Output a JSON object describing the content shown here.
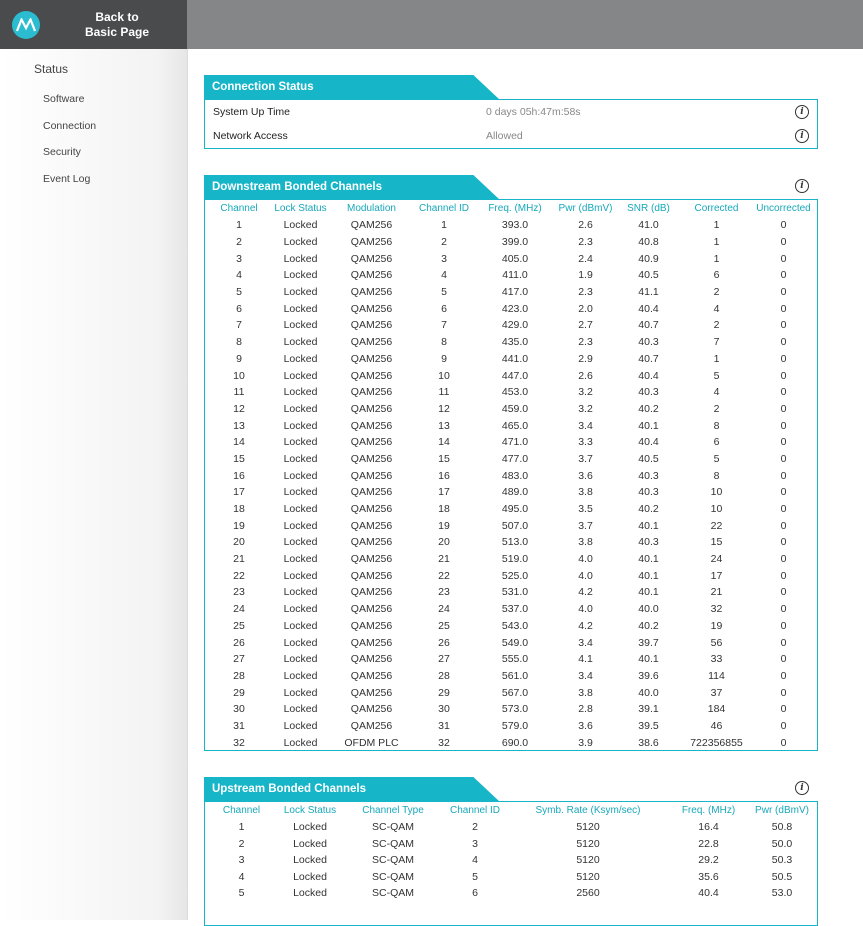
{
  "header": {
    "back_label_line1": "Back to",
    "back_label_line2": "Basic Page"
  },
  "sidebar": {
    "status_label": "Status",
    "items": [
      {
        "label": "Software"
      },
      {
        "label": "Connection"
      },
      {
        "label": "Security"
      },
      {
        "label": "Event Log"
      }
    ]
  },
  "connection_status": {
    "title": "Connection Status",
    "rows": [
      {
        "label": "System Up Time",
        "value": "0 days 05h:47m:58s"
      },
      {
        "label": "Network Access",
        "value": "Allowed"
      }
    ]
  },
  "downstream": {
    "title": "Downstream Bonded Channels",
    "columns": [
      "Channel",
      "Lock Status",
      "Modulation",
      "Channel ID",
      "Freq. (MHz)",
      "Pwr (dBmV)",
      "SNR (dB)",
      "Corrected",
      "Uncorrected"
    ],
    "rows": [
      [
        "1",
        "Locked",
        "QAM256",
        "1",
        "393.0",
        "2.6",
        "41.0",
        "1",
        "0"
      ],
      [
        "2",
        "Locked",
        "QAM256",
        "2",
        "399.0",
        "2.3",
        "40.8",
        "1",
        "0"
      ],
      [
        "3",
        "Locked",
        "QAM256",
        "3",
        "405.0",
        "2.4",
        "40.9",
        "1",
        "0"
      ],
      [
        "4",
        "Locked",
        "QAM256",
        "4",
        "411.0",
        "1.9",
        "40.5",
        "6",
        "0"
      ],
      [
        "5",
        "Locked",
        "QAM256",
        "5",
        "417.0",
        "2.3",
        "41.1",
        "2",
        "0"
      ],
      [
        "6",
        "Locked",
        "QAM256",
        "6",
        "423.0",
        "2.0",
        "40.4",
        "4",
        "0"
      ],
      [
        "7",
        "Locked",
        "QAM256",
        "7",
        "429.0",
        "2.7",
        "40.7",
        "2",
        "0"
      ],
      [
        "8",
        "Locked",
        "QAM256",
        "8",
        "435.0",
        "2.3",
        "40.3",
        "7",
        "0"
      ],
      [
        "9",
        "Locked",
        "QAM256",
        "9",
        "441.0",
        "2.9",
        "40.7",
        "1",
        "0"
      ],
      [
        "10",
        "Locked",
        "QAM256",
        "10",
        "447.0",
        "2.6",
        "40.4",
        "5",
        "0"
      ],
      [
        "11",
        "Locked",
        "QAM256",
        "11",
        "453.0",
        "3.2",
        "40.3",
        "4",
        "0"
      ],
      [
        "12",
        "Locked",
        "QAM256",
        "12",
        "459.0",
        "3.2",
        "40.2",
        "2",
        "0"
      ],
      [
        "13",
        "Locked",
        "QAM256",
        "13",
        "465.0",
        "3.4",
        "40.1",
        "8",
        "0"
      ],
      [
        "14",
        "Locked",
        "QAM256",
        "14",
        "471.0",
        "3.3",
        "40.4",
        "6",
        "0"
      ],
      [
        "15",
        "Locked",
        "QAM256",
        "15",
        "477.0",
        "3.7",
        "40.5",
        "5",
        "0"
      ],
      [
        "16",
        "Locked",
        "QAM256",
        "16",
        "483.0",
        "3.6",
        "40.3",
        "8",
        "0"
      ],
      [
        "17",
        "Locked",
        "QAM256",
        "17",
        "489.0",
        "3.8",
        "40.3",
        "10",
        "0"
      ],
      [
        "18",
        "Locked",
        "QAM256",
        "18",
        "495.0",
        "3.5",
        "40.2",
        "10",
        "0"
      ],
      [
        "19",
        "Locked",
        "QAM256",
        "19",
        "507.0",
        "3.7",
        "40.1",
        "22",
        "0"
      ],
      [
        "20",
        "Locked",
        "QAM256",
        "20",
        "513.0",
        "3.8",
        "40.3",
        "15",
        "0"
      ],
      [
        "21",
        "Locked",
        "QAM256",
        "21",
        "519.0",
        "4.0",
        "40.1",
        "24",
        "0"
      ],
      [
        "22",
        "Locked",
        "QAM256",
        "22",
        "525.0",
        "4.0",
        "40.1",
        "17",
        "0"
      ],
      [
        "23",
        "Locked",
        "QAM256",
        "23",
        "531.0",
        "4.2",
        "40.1",
        "21",
        "0"
      ],
      [
        "24",
        "Locked",
        "QAM256",
        "24",
        "537.0",
        "4.0",
        "40.0",
        "32",
        "0"
      ],
      [
        "25",
        "Locked",
        "QAM256",
        "25",
        "543.0",
        "4.2",
        "40.2",
        "19",
        "0"
      ],
      [
        "26",
        "Locked",
        "QAM256",
        "26",
        "549.0",
        "3.4",
        "39.7",
        "56",
        "0"
      ],
      [
        "27",
        "Locked",
        "QAM256",
        "27",
        "555.0",
        "4.1",
        "40.1",
        "33",
        "0"
      ],
      [
        "28",
        "Locked",
        "QAM256",
        "28",
        "561.0",
        "3.4",
        "39.6",
        "114",
        "0"
      ],
      [
        "29",
        "Locked",
        "QAM256",
        "29",
        "567.0",
        "3.8",
        "40.0",
        "37",
        "0"
      ],
      [
        "30",
        "Locked",
        "QAM256",
        "30",
        "573.0",
        "2.8",
        "39.1",
        "184",
        "0"
      ],
      [
        "31",
        "Locked",
        "QAM256",
        "31",
        "579.0",
        "3.6",
        "39.5",
        "46",
        "0"
      ],
      [
        "32",
        "Locked",
        "OFDM PLC",
        "32",
        "690.0",
        "3.9",
        "38.6",
        "722356855",
        "0"
      ]
    ]
  },
  "upstream": {
    "title": "Upstream Bonded Channels",
    "columns": [
      "Channel",
      "Lock Status",
      "Channel Type",
      "Channel ID",
      "Symb. Rate (Ksym/sec)",
      "Freq. (MHz)",
      "Pwr (dBmV)"
    ],
    "rows": [
      [
        "1",
        "Locked",
        "SC-QAM",
        "2",
        "5120",
        "16.4",
        "50.8"
      ],
      [
        "2",
        "Locked",
        "SC-QAM",
        "3",
        "5120",
        "22.8",
        "50.0"
      ],
      [
        "3",
        "Locked",
        "SC-QAM",
        "4",
        "5120",
        "29.2",
        "50.3"
      ],
      [
        "4",
        "Locked",
        "SC-QAM",
        "5",
        "5120",
        "35.6",
        "50.5"
      ],
      [
        "5",
        "Locked",
        "SC-QAM",
        "6",
        "2560",
        "40.4",
        "53.0"
      ]
    ]
  },
  "colors": {
    "accent": "#17b5c8",
    "header_text": "#17a8bb",
    "top_bar": "#858688",
    "logo_bg": "#4a4b4d"
  },
  "icons": {
    "logo": "motorola-logo-icon",
    "info": "info-icon"
  }
}
